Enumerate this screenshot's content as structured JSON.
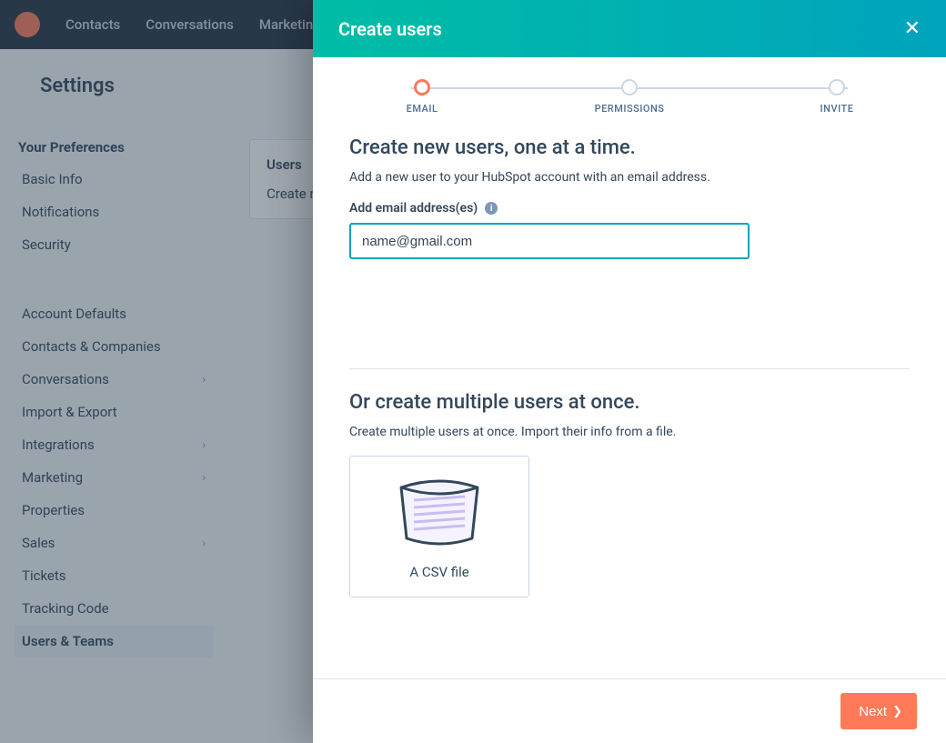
{
  "topnav": {
    "items": [
      "Contacts",
      "Conversations",
      "Marketing"
    ]
  },
  "page": {
    "title": "Settings"
  },
  "sidebar": {
    "section1_label": "Your Preferences",
    "basic_info": "Basic Info",
    "notifications": "Notifications",
    "security_pref": "Security",
    "account_defaults": "Account Defaults",
    "contacts_companies": "Contacts & Companies",
    "conversations": "Conversations",
    "import_export": "Import & Export",
    "integrations": "Integrations",
    "marketing": "Marketing",
    "properties": "Properties",
    "sales": "Sales",
    "tickets": "Tickets",
    "tracking_code": "Tracking Code",
    "users_teams": "Users & Teams"
  },
  "content": {
    "tab_users": "Users",
    "create_hint": "Create new"
  },
  "modal": {
    "title": "Create users",
    "steps": {
      "email": "EMAIL",
      "permissions": "PERMISSIONS",
      "invite": "INVITE"
    },
    "single": {
      "heading": "Create new users, one at a time.",
      "desc": "Add a new user to your HubSpot account with an email address.",
      "field_label": "Add email address(es)",
      "email_value": "name@gmail.com"
    },
    "multi": {
      "heading": "Or create multiple users at once.",
      "desc": "Create multiple users at once. Import their info from a file.",
      "csv_caption": "A CSV file"
    },
    "footer": {
      "next": "Next"
    }
  }
}
